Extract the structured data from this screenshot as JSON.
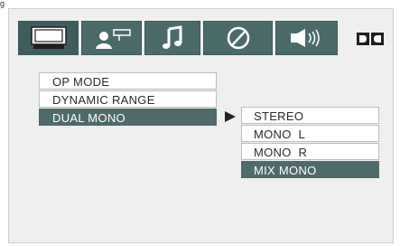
{
  "page_top_text": "g",
  "tabs": [
    {
      "id": "general",
      "icon": "monitor-icon"
    },
    {
      "id": "user",
      "icon": "user-remote-icon"
    },
    {
      "id": "audio",
      "icon": "music-note-icon"
    },
    {
      "id": "preference",
      "icon": "circle-slash-icon"
    },
    {
      "id": "speaker",
      "icon": "speaker-icon"
    }
  ],
  "brand": {
    "icon": "dolby-logo"
  },
  "menu": {
    "items": [
      "OP MODE",
      "DYNAMIC RANGE",
      "DUAL MONO"
    ],
    "selected_index": 2
  },
  "submenu": {
    "items": [
      "STEREO",
      "MONO  L",
      "MONO  R",
      "MIX MONO"
    ],
    "selected_index": 3
  },
  "colors": {
    "tab_bg": "#4b6b6b",
    "highlight": "#4e6a6a",
    "screen_bg": "#efefef"
  }
}
